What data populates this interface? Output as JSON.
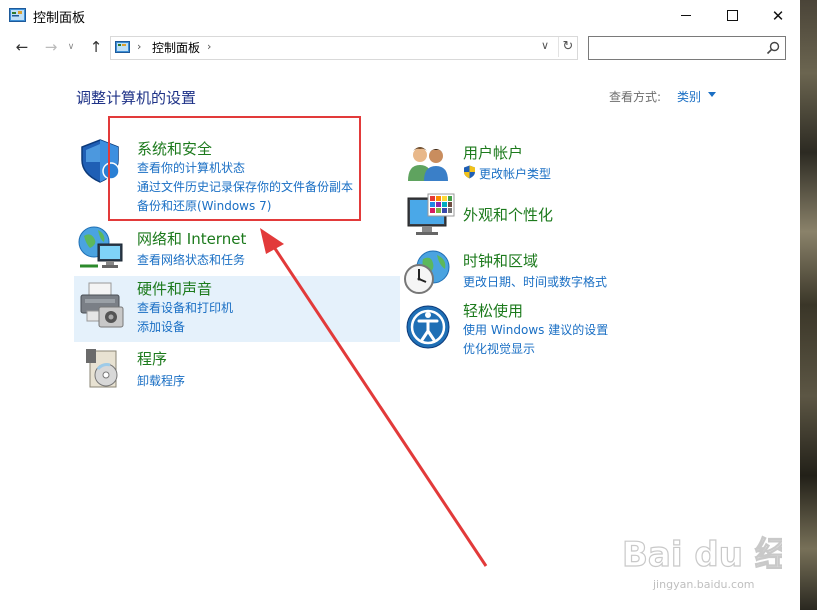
{
  "window": {
    "title": "控制面板",
    "title_icon": "control-panel-icon",
    "controls": {
      "minimize": "minimize-icon",
      "maximize": "maximize-icon",
      "close_glyph": "✕"
    }
  },
  "navigation": {
    "back_glyph": "←",
    "forward_glyph": "→",
    "recent_glyph": "∨",
    "up_glyph": "↑",
    "address": {
      "separator": "›",
      "path": "控制面板",
      "dropdown_glyph": "∨",
      "refresh_glyph": "↻"
    },
    "search": {
      "value": "",
      "placeholder": ""
    }
  },
  "main": {
    "heading": "调整计算机的设置",
    "view_by": {
      "label": "查看方式:",
      "value": "类别"
    },
    "categories": [
      {
        "title": "系统和安全",
        "icon": "shield-icon",
        "links": [
          "查看你的计算机状态",
          "通过文件历史记录保存你的文件备份副本",
          "备份和还原(Windows 7)"
        ]
      },
      {
        "title": "网络和 Internet",
        "icon": "network-globe-icon",
        "links": [
          "查看网络状态和任务"
        ]
      },
      {
        "title": "硬件和声音",
        "icon": "printer-icon",
        "links": [
          "查看设备和打印机",
          "添加设备"
        ]
      },
      {
        "title": "程序",
        "icon": "programs-disc-icon",
        "links": [
          "卸载程序"
        ]
      },
      {
        "title": "用户帐户",
        "icon": "users-icon",
        "links": [
          "更改帐户类型"
        ]
      },
      {
        "title": "外观和个性化",
        "icon": "monitor-palette-icon",
        "links": []
      },
      {
        "title": "时钟和区域",
        "icon": "clock-globe-icon",
        "links": [
          "更改日期、时间或数字格式"
        ]
      },
      {
        "title": "轻松使用",
        "icon": "ease-of-access-icon",
        "links": [
          "使用 Windows 建议的设置",
          "优化视觉显示"
        ]
      }
    ]
  },
  "annotation": {
    "highlight_color": "#e23a3a",
    "arrow_color": "#e23a3a"
  },
  "watermark": {
    "brand": "Bai du 经验",
    "url": "jingyan.baidu.com"
  },
  "colors": {
    "link": "#1a6fc4",
    "category_title": "#1c7a1c",
    "heading": "#1e3287",
    "hover": "#e5f1fb"
  }
}
